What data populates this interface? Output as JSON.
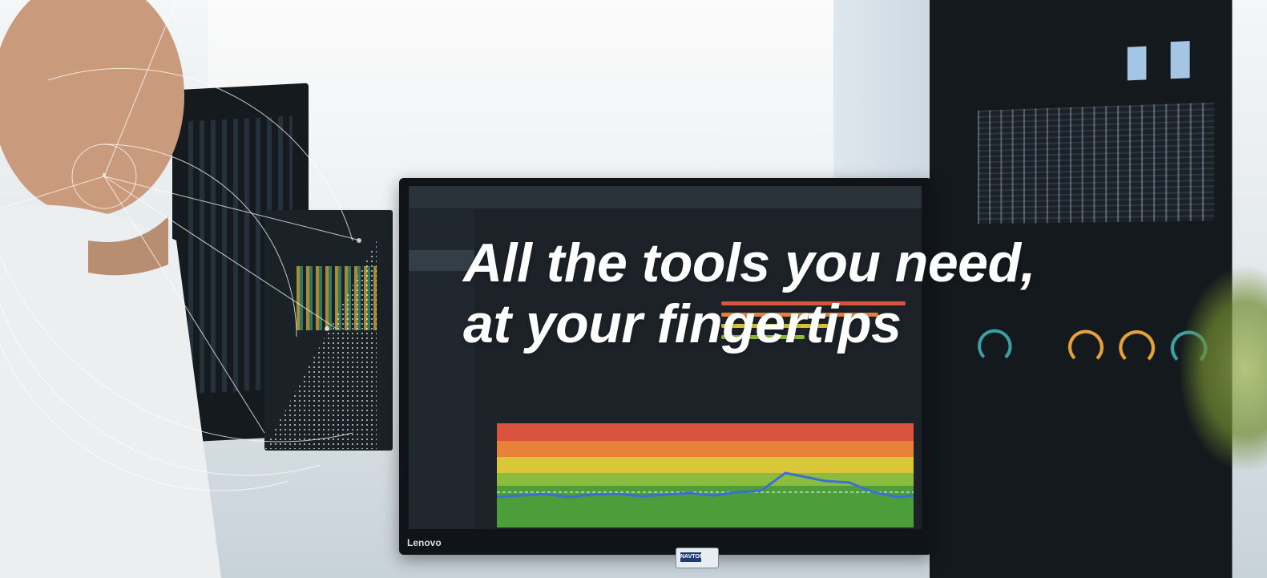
{
  "headline": {
    "line1": "All the tools you need,",
    "line2": "at your fingertips"
  },
  "monitor": {
    "brand": "Lenovo",
    "badge_text": "NAVTOR"
  },
  "colors": {
    "headline": "#ffffff",
    "cii_red": "#d9533f",
    "cii_orange": "#e8823a",
    "cii_yellow": "#d8c738",
    "cii_lightgreen": "#8cbc3d",
    "cii_green": "#4b9e3a",
    "trend_line": "#3b6fd4"
  }
}
